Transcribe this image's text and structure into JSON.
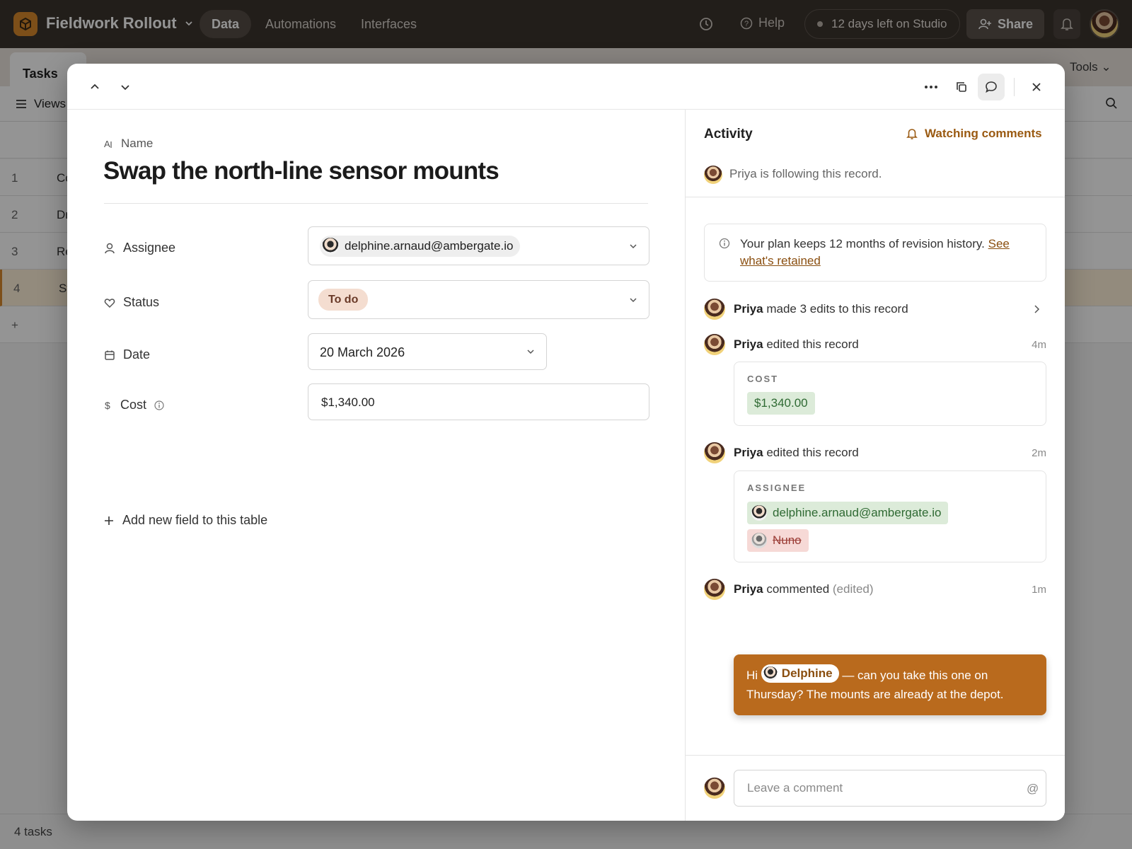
{
  "app": {
    "base_name": "Fieldwork Rollout",
    "nav": [
      "Data",
      "Automations",
      "Interfaces"
    ],
    "help_label": "Help",
    "trial_label": "12 days left on Studio",
    "share_label": "Share",
    "icons": [
      "box-logo-icon",
      "history-icon",
      "help-icon",
      "bell-icon",
      "share-user-icon"
    ],
    "accent": "#d7892b"
  },
  "table": {
    "tab_label": "Tasks",
    "tools_label": "Tools",
    "views_label": "Views",
    "rows": [
      {
        "num": "1",
        "name": "Co"
      },
      {
        "num": "2",
        "name": "Dr"
      },
      {
        "num": "3",
        "name": "Re"
      },
      {
        "num": "4",
        "name": "Sv"
      }
    ],
    "add_row": "+",
    "footer": "4 tasks"
  },
  "record": {
    "name_label": "Name",
    "title": "Swap the north-line sensor mounts",
    "fields": {
      "assignee": {
        "label": "Assignee",
        "value": "delphine.arnaud@ambergate.io"
      },
      "status": {
        "label": "Status",
        "value": "To do"
      },
      "date": {
        "label": "Date",
        "value": "20 March 2026"
      },
      "cost": {
        "label": "Cost",
        "value": "$1,340.00"
      }
    },
    "add_field_label": "Add new field to this table"
  },
  "activity": {
    "title": "Activity",
    "watching_label": "Watching comments",
    "following_text": "Priya is following this record.",
    "plan_text": "Your plan keeps 12 months of revision history.",
    "plan_link": "See what's retained",
    "events": [
      {
        "user": "Priya",
        "action": "made 3 edits to this record"
      },
      {
        "user": "Priya",
        "action": "edited this record",
        "time": "4m",
        "field": "COST",
        "added": "$1,340.00"
      },
      {
        "user": "Priya",
        "action": "edited this record",
        "time": "2m",
        "field": "ASSIGNEE",
        "added": "delphine.arnaud@ambergate.io",
        "removed": "Nuno"
      },
      {
        "user": "Priya",
        "action": "commented",
        "edited": "(edited)",
        "time": "1m",
        "comment_pre": "Hi",
        "mention": "Delphine",
        "comment_post": "— can you take this one on Thursday? The mounts are already at the depot."
      }
    ],
    "comment_placeholder": "Leave a comment",
    "at_symbol": "@"
  }
}
